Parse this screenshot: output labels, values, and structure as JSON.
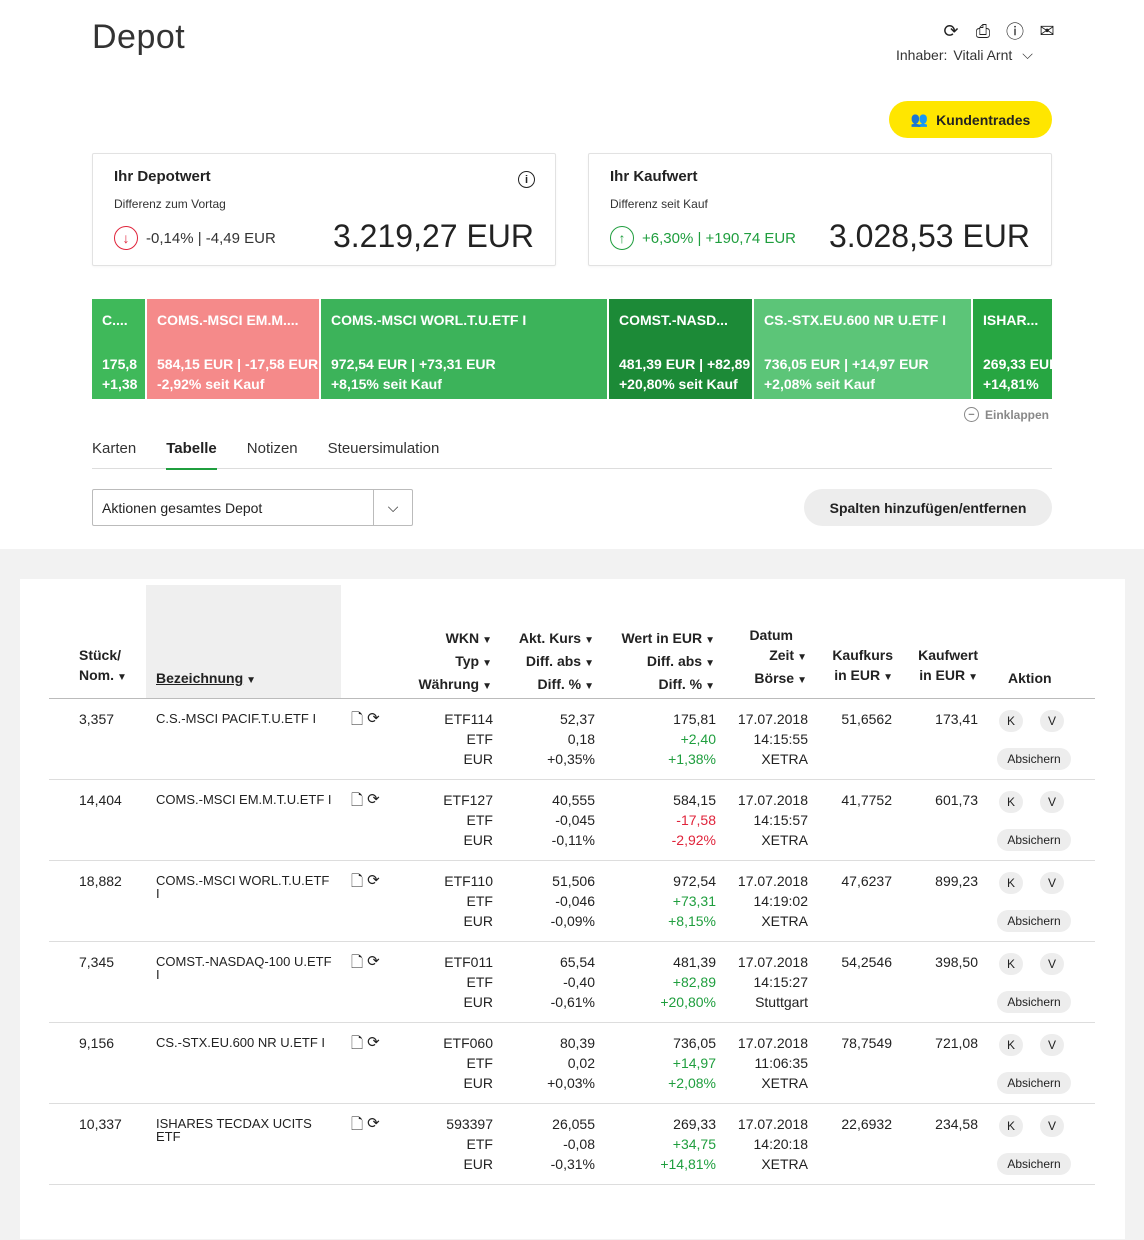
{
  "header": {
    "title": "Depot",
    "owner_label": "Inhaber:",
    "owner_name": "Vitali Arnt",
    "kundentrades_label": "Kundentrades"
  },
  "cards": {
    "depotwert": {
      "title": "Ihr Depotwert",
      "subtitle": "Differenz zum Vortag",
      "diff": "-0,14% | -4,49 EUR",
      "value": "3.219,27 EUR"
    },
    "kaufwert": {
      "title": "Ihr Kaufwert",
      "subtitle": "Differenz seit Kauf",
      "diff": "+6,30% | +190,74 EUR",
      "value": "3.028,53 EUR"
    }
  },
  "tiles": [
    {
      "name": "C....",
      "val": "175,8",
      "pct": "+1,38",
      "color": "#3fb95a"
    },
    {
      "name": "COMS.-MSCI EM.M....",
      "val": "584,15 EUR | -17,58 EUR",
      "pct": "-2,92% seit Kauf",
      "color": "#f58a8a"
    },
    {
      "name": "COMS.-MSCI WORL.T.U.ETF I",
      "val": "972,54 EUR | +73,31 EUR",
      "pct": "+8,15% seit Kauf",
      "color": "#3cb35a"
    },
    {
      "name": "COMST.-NASD...",
      "val": "481,39 EUR | +82,89",
      "pct": "+20,80% seit Kauf",
      "color": "#1c8a37"
    },
    {
      "name": "CS.-STX.EU.600 NR U.ETF I",
      "val": "736,05 EUR | +14,97 EUR",
      "pct": "+2,08% seit Kauf",
      "color": "#5cc578"
    },
    {
      "name": "ISHAR...",
      "val": "269,33 EUR",
      "pct": "+14,81%",
      "color": "#27a642"
    }
  ],
  "collapse_label": "Einklappen",
  "tabs": [
    "Karten",
    "Tabelle",
    "Notizen",
    "Steuersimulation"
  ],
  "active_tab": "Tabelle",
  "actions_select": "Aktionen gesamtes Depot",
  "columns_button": "Spalten hinzufügen/entfernen",
  "table": {
    "headers": {
      "stueck": [
        "Stück/",
        "Nom."
      ],
      "bezeichnung": "Bezeichnung",
      "wkn": [
        "WKN",
        "Typ",
        "Währung"
      ],
      "kurs": [
        "Akt. Kurs",
        "Diff. abs",
        "Diff. %"
      ],
      "wert": [
        "Wert in EUR",
        "Diff. abs",
        "Diff. %"
      ],
      "datum": [
        "Datum",
        "Zeit",
        "Börse"
      ],
      "kaufkurs": [
        "Kaufkurs",
        "in EUR"
      ],
      "kaufwert": [
        "Kaufwert",
        "in EUR"
      ],
      "aktion": "Aktion"
    },
    "rows": [
      {
        "stueck": "3,357",
        "name": "C.S.-MSCI PACIF.T.U.ETF I",
        "wkn": "ETF114",
        "typ": "ETF",
        "waehrung": "EUR",
        "kurs": "52,37",
        "kurs_diff": "0,18",
        "kurs_pct": "+0,35%",
        "wert": "175,81",
        "wert_diff": "+2,40",
        "wert_pct": "+1,38%",
        "wert_sign": "pos",
        "datum": "17.07.2018",
        "zeit": "14:15:55",
        "boerse": "XETRA",
        "kaufkurs": "51,6562",
        "kaufwert": "173,41"
      },
      {
        "stueck": "14,404",
        "name": "COMS.-MSCI EM.M.T.U.ETF I",
        "wkn": "ETF127",
        "typ": "ETF",
        "waehrung": "EUR",
        "kurs": "40,555",
        "kurs_diff": "-0,045",
        "kurs_pct": "-0,11%",
        "wert": "584,15",
        "wert_diff": "-17,58",
        "wert_pct": "-2,92%",
        "wert_sign": "neg",
        "datum": "17.07.2018",
        "zeit": "14:15:57",
        "boerse": "XETRA",
        "kaufkurs": "41,7752",
        "kaufwert": "601,73"
      },
      {
        "stueck": "18,882",
        "name": "COMS.-MSCI WORL.T.U.ETF I",
        "wkn": "ETF110",
        "typ": "ETF",
        "waehrung": "EUR",
        "kurs": "51,506",
        "kurs_diff": "-0,046",
        "kurs_pct": "-0,09%",
        "wert": "972,54",
        "wert_diff": "+73,31",
        "wert_pct": "+8,15%",
        "wert_sign": "pos",
        "datum": "17.07.2018",
        "zeit": "14:19:02",
        "boerse": "XETRA",
        "kaufkurs": "47,6237",
        "kaufwert": "899,23"
      },
      {
        "stueck": "7,345",
        "name": "COMST.-NASDAQ-100 U.ETF I",
        "wkn": "ETF011",
        "typ": "ETF",
        "waehrung": "EUR",
        "kurs": "65,54",
        "kurs_diff": "-0,40",
        "kurs_pct": "-0,61%",
        "wert": "481,39",
        "wert_diff": "+82,89",
        "wert_pct": "+20,80%",
        "wert_sign": "pos",
        "datum": "17.07.2018",
        "zeit": "14:15:27",
        "boerse": "Stuttgart",
        "kaufkurs": "54,2546",
        "kaufwert": "398,50"
      },
      {
        "stueck": "9,156",
        "name": "CS.-STX.EU.600 NR U.ETF I",
        "wkn": "ETF060",
        "typ": "ETF",
        "waehrung": "EUR",
        "kurs": "80,39",
        "kurs_diff": "0,02",
        "kurs_pct": "+0,03%",
        "wert": "736,05",
        "wert_diff": "+14,97",
        "wert_pct": "+2,08%",
        "wert_sign": "pos",
        "datum": "17.07.2018",
        "zeit": "11:06:35",
        "boerse": "XETRA",
        "kaufkurs": "78,7549",
        "kaufwert": "721,08"
      },
      {
        "stueck": "10,337",
        "name": "ISHARES TECDAX UCITS ETF",
        "wkn": "593397",
        "typ": "ETF",
        "waehrung": "EUR",
        "kurs": "26,055",
        "kurs_diff": "-0,08",
        "kurs_pct": "-0,31%",
        "wert": "269,33",
        "wert_diff": "+34,75",
        "wert_pct": "+14,81%",
        "wert_sign": "pos",
        "datum": "17.07.2018",
        "zeit": "14:20:18",
        "boerse": "XETRA",
        "kaufkurs": "22,6932",
        "kaufwert": "234,58"
      }
    ],
    "buy_label": "K",
    "sell_label": "V",
    "hedge_label": "Absichern"
  },
  "colors": {
    "accent_yellow": "#ffe600",
    "positive": "#1f9e3e",
    "negative": "#e0243b"
  }
}
